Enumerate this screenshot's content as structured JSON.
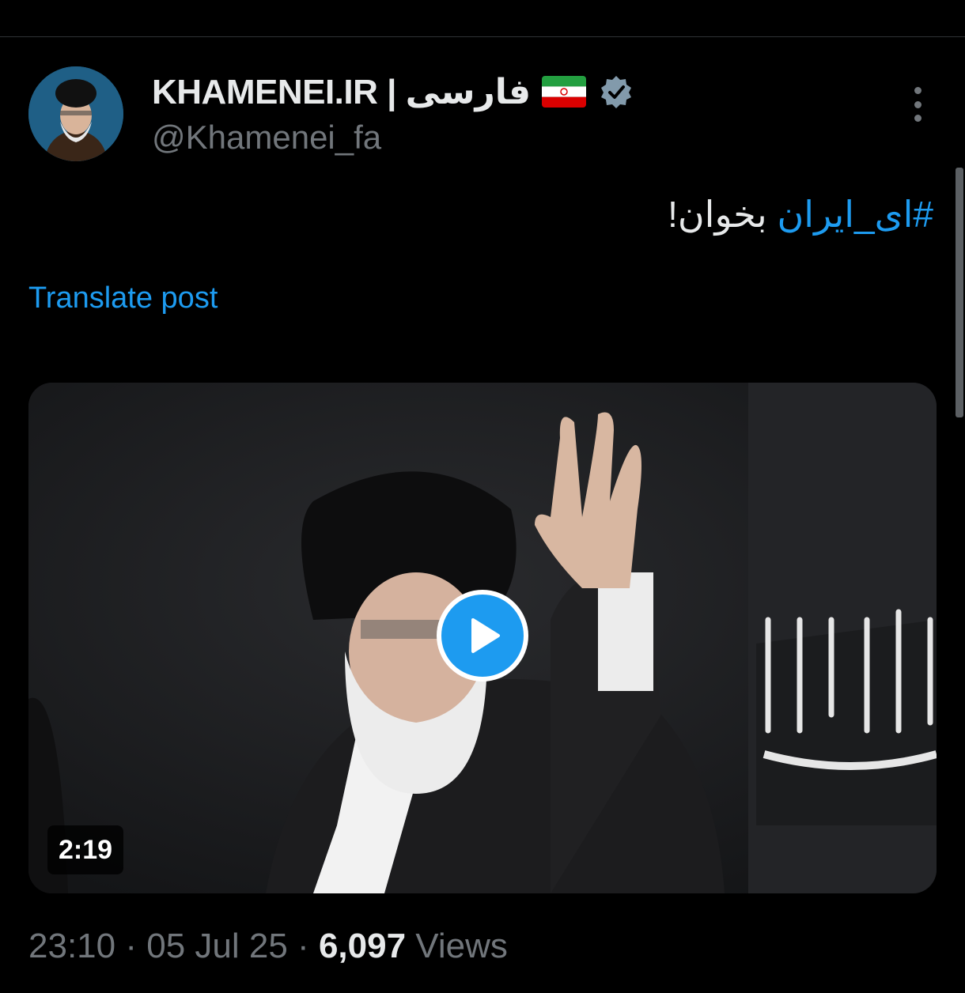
{
  "author": {
    "display_name": "KHAMENEI.IR | فارسی",
    "flag_icon": "iran-flag-icon",
    "verified_icon": "verified-badge-icon",
    "handle": "@Khamenei_fa"
  },
  "post": {
    "hashtag": "#ای_ایران",
    "text_rest": "بخوان!",
    "translate_label": "Translate post"
  },
  "media": {
    "type": "video",
    "duration": "2:19",
    "play_icon": "play-icon"
  },
  "meta": {
    "time": "23:10",
    "separator": "·",
    "date": "05 Jul 25",
    "views_count": "6,097",
    "views_label": "Views"
  },
  "colors": {
    "background": "#000000",
    "accent": "#1d9bf0",
    "secondary_text": "#71767b",
    "primary_text": "#e7e9ea"
  }
}
